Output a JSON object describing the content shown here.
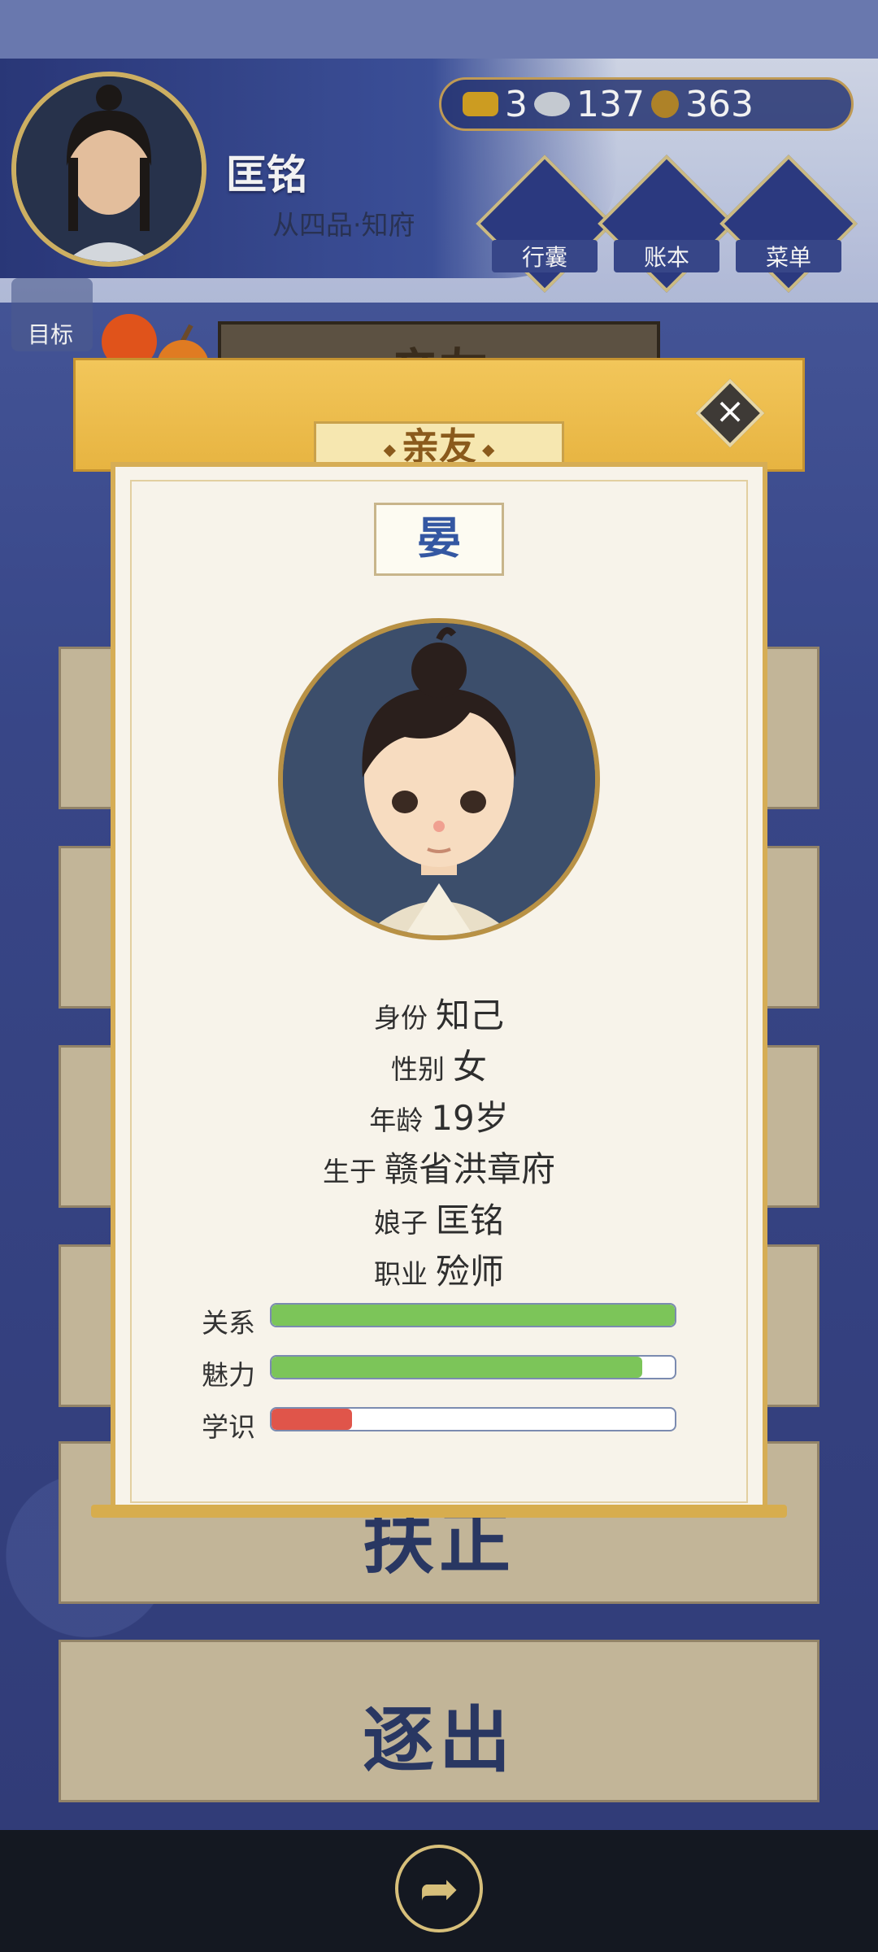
{
  "player": {
    "name": "匡铭",
    "rank": "从四品·知府"
  },
  "currency": {
    "gold": "3",
    "silver": "137",
    "coins": "363"
  },
  "menu": {
    "bag": "行囊",
    "ledger": "账本",
    "menu": "菜单"
  },
  "goal_label": "目标",
  "background_title": "亲友",
  "background_actions": {
    "correct": "扶正",
    "expel": "逐出"
  },
  "modal": {
    "title": "亲友",
    "surname": "晏",
    "fields": [
      {
        "key": "身份",
        "value": "知己"
      },
      {
        "key": "性别",
        "value": "女"
      },
      {
        "key": "年龄",
        "value": "19岁"
      },
      {
        "key": "生于",
        "value": "赣省洪章府"
      },
      {
        "key": "娘子",
        "value": "匡铭"
      },
      {
        "key": "职业",
        "value": "殓师"
      }
    ],
    "stats": [
      {
        "label": "关系",
        "level": 1.0,
        "color": "#7cc559"
      },
      {
        "label": "魅力",
        "level": 0.92,
        "color": "#7cc559"
      },
      {
        "label": "学识",
        "level": 0.2,
        "color": "#e0554a"
      }
    ]
  },
  "colors": {
    "accent_gold": "#e7b441",
    "navy": "#3b4a8f"
  }
}
